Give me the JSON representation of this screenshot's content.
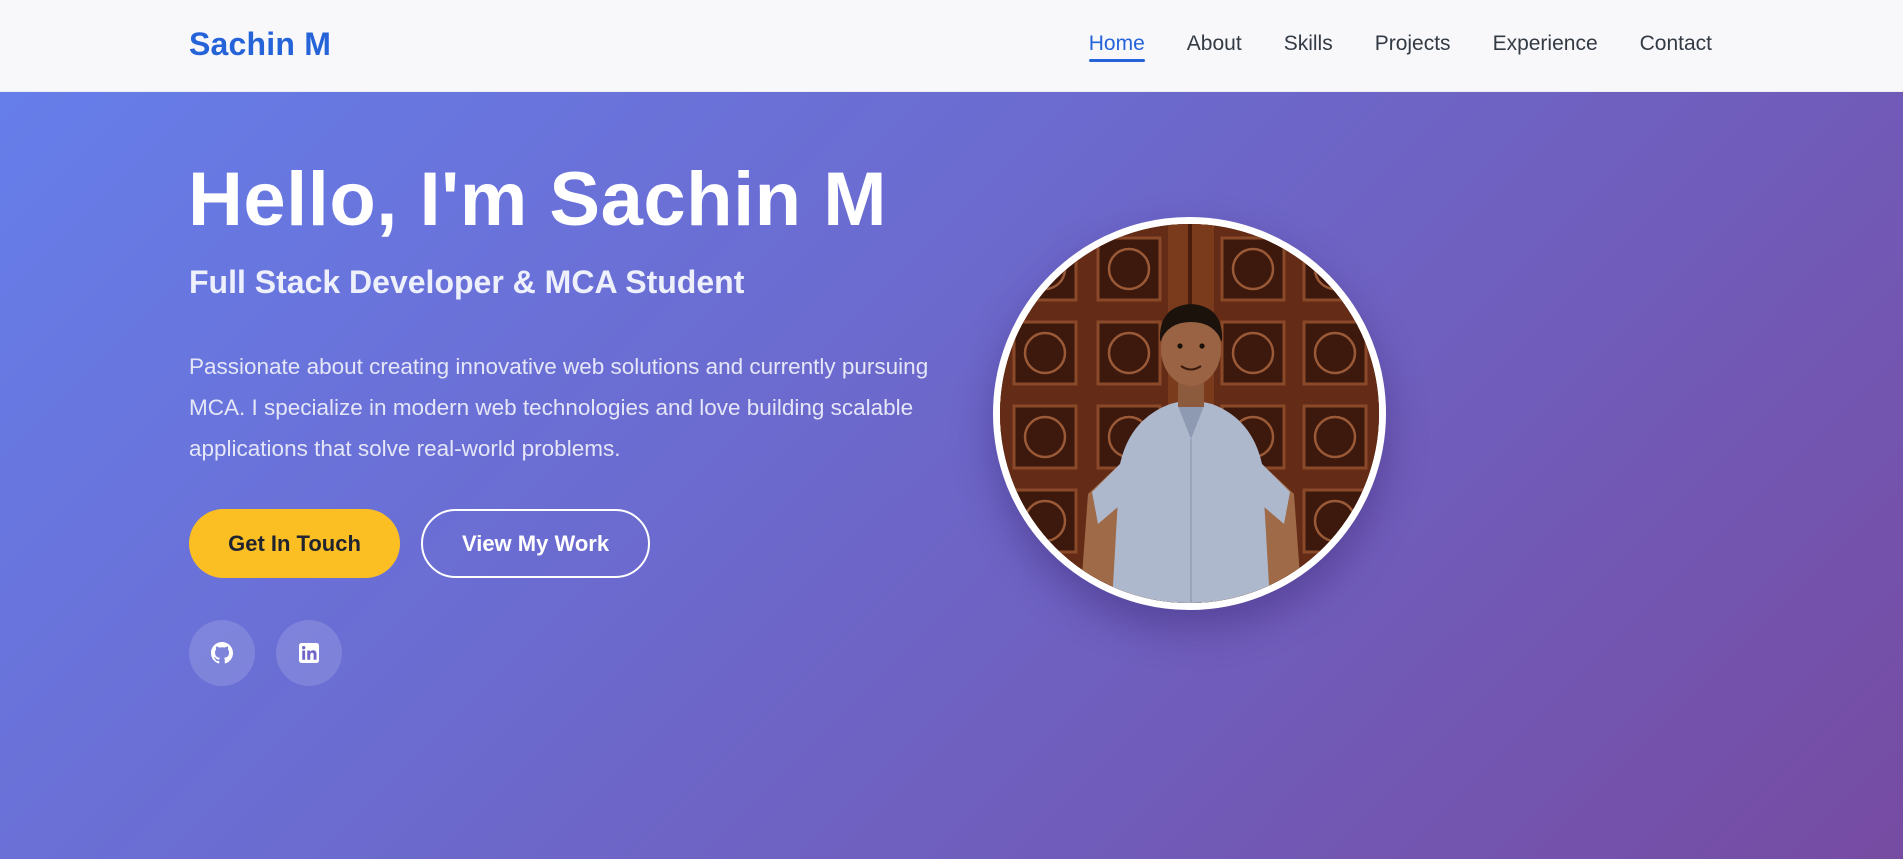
{
  "navbar": {
    "brand": "Sachin M",
    "links": [
      {
        "label": "Home",
        "active": true
      },
      {
        "label": "About",
        "active": false
      },
      {
        "label": "Skills",
        "active": false
      },
      {
        "label": "Projects",
        "active": false
      },
      {
        "label": "Experience",
        "active": false
      },
      {
        "label": "Contact",
        "active": false
      }
    ],
    "accent_color": "#2563d9"
  },
  "hero": {
    "title": "Hello, I'm Sachin M",
    "subtitle": "Full Stack Developer & MCA Student",
    "description": "Passionate about creating innovative web solutions and currently pursuing MCA. I specialize in modern web technologies and love building scalable applications that solve real-world problems.",
    "buttons": {
      "primary": "Get In Touch",
      "secondary": "View My Work"
    },
    "social": [
      {
        "icon": "github-icon"
      },
      {
        "icon": "linkedin-icon"
      }
    ],
    "gradient": [
      "#667eea",
      "#764ba2"
    ],
    "primary_button_color": "#fbbf24"
  }
}
